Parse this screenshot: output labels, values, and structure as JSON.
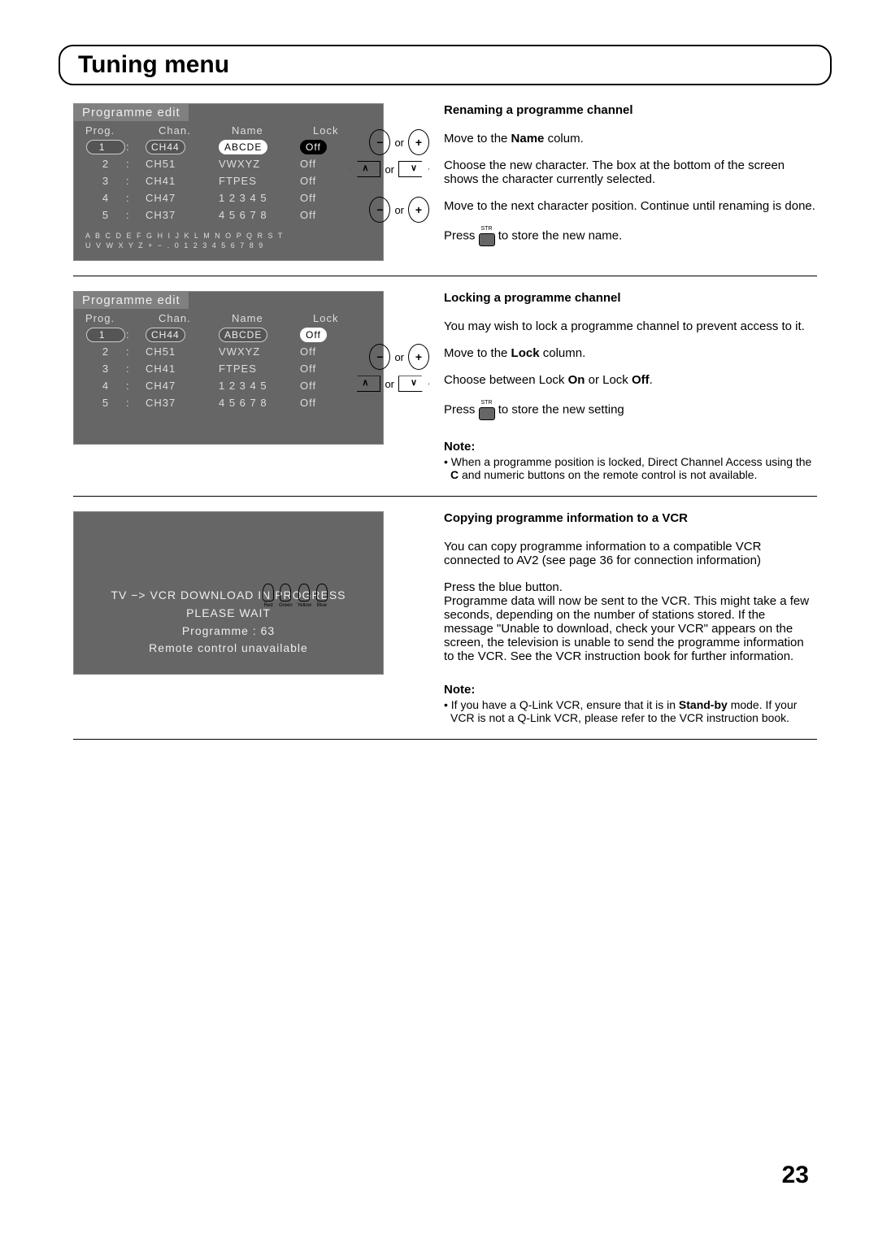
{
  "page": {
    "title": "Tuning menu",
    "number": "23"
  },
  "section1": {
    "heading": "Renaming a programme channel",
    "step1_pre": "Move to the ",
    "step1_bold": "Name",
    "step1_post": " colum.",
    "step2": "Choose the new character. The box at the bottom of the screen shows the character currently selected.",
    "step3": "Move to the next character position. Continue until renaming is done.",
    "step4_pre": "Press ",
    "step4_post": "  to store the new name.",
    "str_label": "STR",
    "or": "or",
    "osd": {
      "title": "Programme edit",
      "cols": [
        "Prog.",
        "Chan.",
        "Name",
        "Lock"
      ],
      "rows": [
        {
          "prog": "1",
          "colon": ":",
          "chan": "CH44",
          "name": "ABCDE",
          "lock": "Off",
          "sel": true,
          "nameWhite": true
        },
        {
          "prog": "2",
          "colon": ":",
          "chan": "CH51",
          "name": "VWXYZ",
          "lock": "Off"
        },
        {
          "prog": "3",
          "colon": ":",
          "chan": "CH41",
          "name": "FTPES",
          "lock": "Off"
        },
        {
          "prog": "4",
          "colon": ":",
          "chan": "CH47",
          "name": "1 2 3 4 5",
          "lock": "Off"
        },
        {
          "prog": "5",
          "colon": ":",
          "chan": "CH37",
          "name": "4 5 6 7 8",
          "lock": "Off"
        }
      ],
      "chars_line1": "A B C D E F G H I J K L M N O P Q R S T",
      "chars_line2": "U V W X Y Z + −  .  0 1 2 3 4 5 6 7 8 9"
    }
  },
  "section2": {
    "heading": "Locking a programme channel",
    "intro": "You may wish to lock a programme channel to prevent access to it.",
    "step1_pre": "Move to the ",
    "step1_bold": "Lock",
    "step1_post": " column.",
    "step2_pre": "Choose between Lock ",
    "step2_bold1": "On",
    "step2_mid": " or Lock ",
    "step2_bold2": "Off",
    "step2_post": ".",
    "step3_pre": "Press ",
    "step3_post": "  to store the new setting",
    "note_label": "Note:",
    "note_pre": "• When a programme position is locked, Direct Channel Access using the ",
    "note_bold": "C",
    "note_post": " and numeric buttons on the remote control is not available.",
    "or": "or",
    "str_label": "STR",
    "osd": {
      "title": "Programme edit",
      "cols": [
        "Prog.",
        "Chan.",
        "Name",
        "Lock"
      ],
      "rows": [
        {
          "prog": "1",
          "colon": ":",
          "chan": "CH44",
          "name": "ABCDE",
          "lock": "Off",
          "sel": true,
          "lockWhite": true
        },
        {
          "prog": "2",
          "colon": ":",
          "chan": "CH51",
          "name": "VWXYZ",
          "lock": "Off"
        },
        {
          "prog": "3",
          "colon": ":",
          "chan": "CH41",
          "name": "FTPES",
          "lock": "Off"
        },
        {
          "prog": "4",
          "colon": ":",
          "chan": "CH47",
          "name": "1 2 3 4 5",
          "lock": "Off"
        },
        {
          "prog": "5",
          "colon": ":",
          "chan": "CH37",
          "name": "4 5 6 7 8",
          "lock": "Off"
        }
      ]
    }
  },
  "section3": {
    "heading": "Copying programme information to a VCR",
    "intro": "You can copy programme information to a compatible VCR connected to AV2 (see page 36 for connection information)",
    "body": "Press the blue button.\nProgramme data will now be sent to the VCR. This might take a few seconds, depending on the number of stations stored. If the message \"Unable to download, check your VCR\" appears on the screen, the television is unable to send the programme information to the VCR. See the VCR instruction book for further information.",
    "note_label": "Note:",
    "note_pre": "• If you have a Q-Link VCR, ensure that it is in ",
    "note_bold": "Stand-by",
    "note_post": " mode. If your VCR is not a Q-Link VCR, please refer to the VCR instruction book.",
    "colors": [
      "Red",
      "Green",
      "Yellow",
      "Blue"
    ],
    "download": {
      "line1": "TV −> VCR DOWNLOAD IN PROGRESS",
      "line2": "PLEASE WAIT",
      "line3": "Programme : 63",
      "line4": "Remote control unavailable"
    }
  }
}
